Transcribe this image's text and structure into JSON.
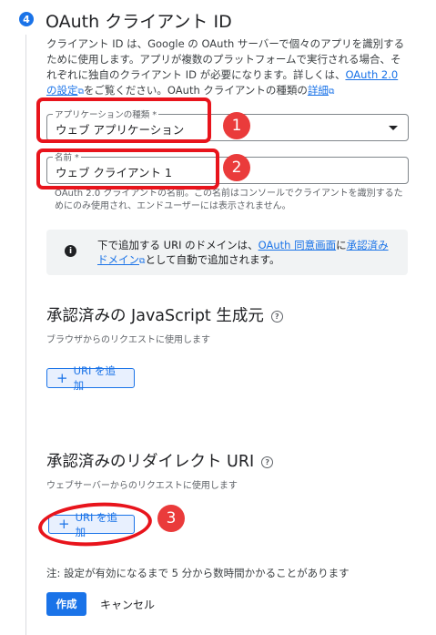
{
  "step": {
    "number": "4",
    "title": "OAuth クライアント ID"
  },
  "description": {
    "text_before_link": "クライアント ID は、Google の OAuth サーバーで個々のアプリを識別するために使用します。アプリが複数のプラットフォームで実行される場合、それぞれに独自のクライアント ID が必要になります。詳しくは、",
    "link1": "OAuth 2.0 の設定",
    "text_mid": "をご覧ください。OAuth クライアントの種類の",
    "link2": "詳細",
    "ext_icon": "external-link-icon"
  },
  "app_type_field": {
    "label": "アプリケーションの種類 *",
    "value": "ウェブ アプリケーション"
  },
  "name_field": {
    "label": "名前 *",
    "value": "ウェブ クライアント 1"
  },
  "name_hint": "OAuth 2.0 クライアントの名前。この名前はコンソールでクライアントを識別するためにのみ使用され、エンドユーザーには表示されません。",
  "info_box": {
    "icon": "info-icon",
    "text_before": "下で追加する URI のドメインは、",
    "link1": "OAuth 同意画面",
    "text_mid": "に",
    "link2": "承認済みドメイン",
    "text_after": "として自動で追加されます。"
  },
  "js_origins": {
    "title": "承認済みの JavaScript 生成元",
    "subtitle": "ブラウザからのリクエストに使用します",
    "add_button": "URI を追加"
  },
  "redirect_uris": {
    "title": "承認済みのリダイレクト URI",
    "subtitle": "ウェブサーバーからのリクエストに使用します",
    "add_button": "URI を追加"
  },
  "note": "注: 設定が有効になるまで 5 分から数時間かかることがあります",
  "actions": {
    "create": "作成",
    "cancel": "キャンセル"
  },
  "annotations": {
    "one": "1",
    "two": "2",
    "three": "3"
  },
  "colors": {
    "accent": "#1a73e8",
    "annotation_red": "#e8141c"
  }
}
